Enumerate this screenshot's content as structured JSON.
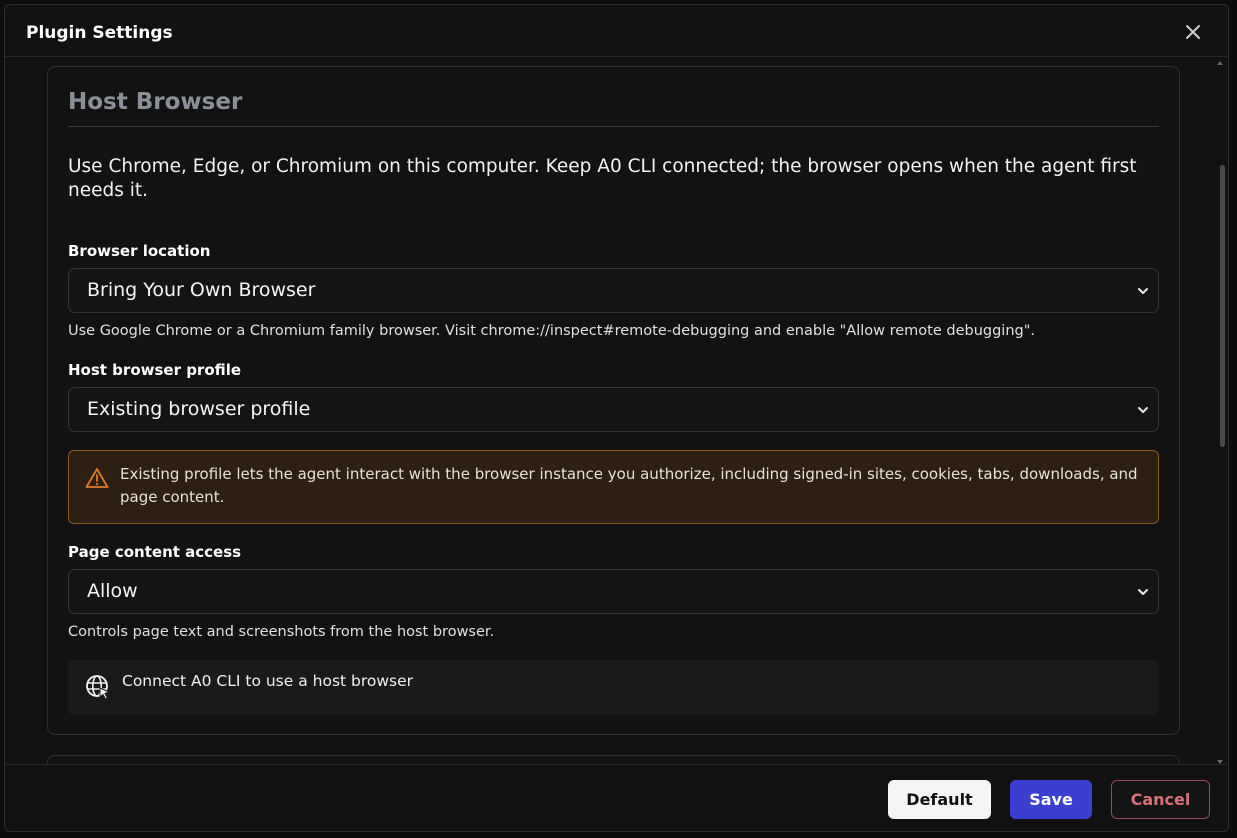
{
  "dialog": {
    "title": "Plugin Settings"
  },
  "section": {
    "title": "Host Browser",
    "description": "Use Chrome, Edge, or Chromium on this computer. Keep A0 CLI connected; the browser opens when the agent first needs it."
  },
  "fields": {
    "browser_location": {
      "label": "Browser location",
      "value": "Bring Your Own Browser",
      "help": "Use Google Chrome or a Chromium family browser. Visit chrome://inspect#remote-debugging and enable \"Allow remote debugging\"."
    },
    "host_profile": {
      "label": "Host browser profile",
      "value": "Existing browser profile"
    },
    "warning": {
      "text": "Existing profile lets the agent interact with the browser instance you authorize, including signed-in sites, cookies, tabs, downloads, and page content."
    },
    "page_access": {
      "label": "Page content access",
      "value": "Allow",
      "help": "Controls page text and screenshots from the host browser."
    }
  },
  "connect": {
    "text": "Connect A0 CLI to use a host browser"
  },
  "footer": {
    "default_label": "Default",
    "save_label": "Save",
    "cancel_label": "Cancel"
  },
  "icons": {
    "close": "close-icon",
    "chevron": "chevron-down-icon",
    "warning": "warning-triangle-icon",
    "globe": "globe-cursor-icon"
  },
  "colors": {
    "accent": "#3b3fd0",
    "warning_border": "#8a5a22",
    "warning_bg": "#2d2013",
    "cancel": "#d9707a"
  }
}
